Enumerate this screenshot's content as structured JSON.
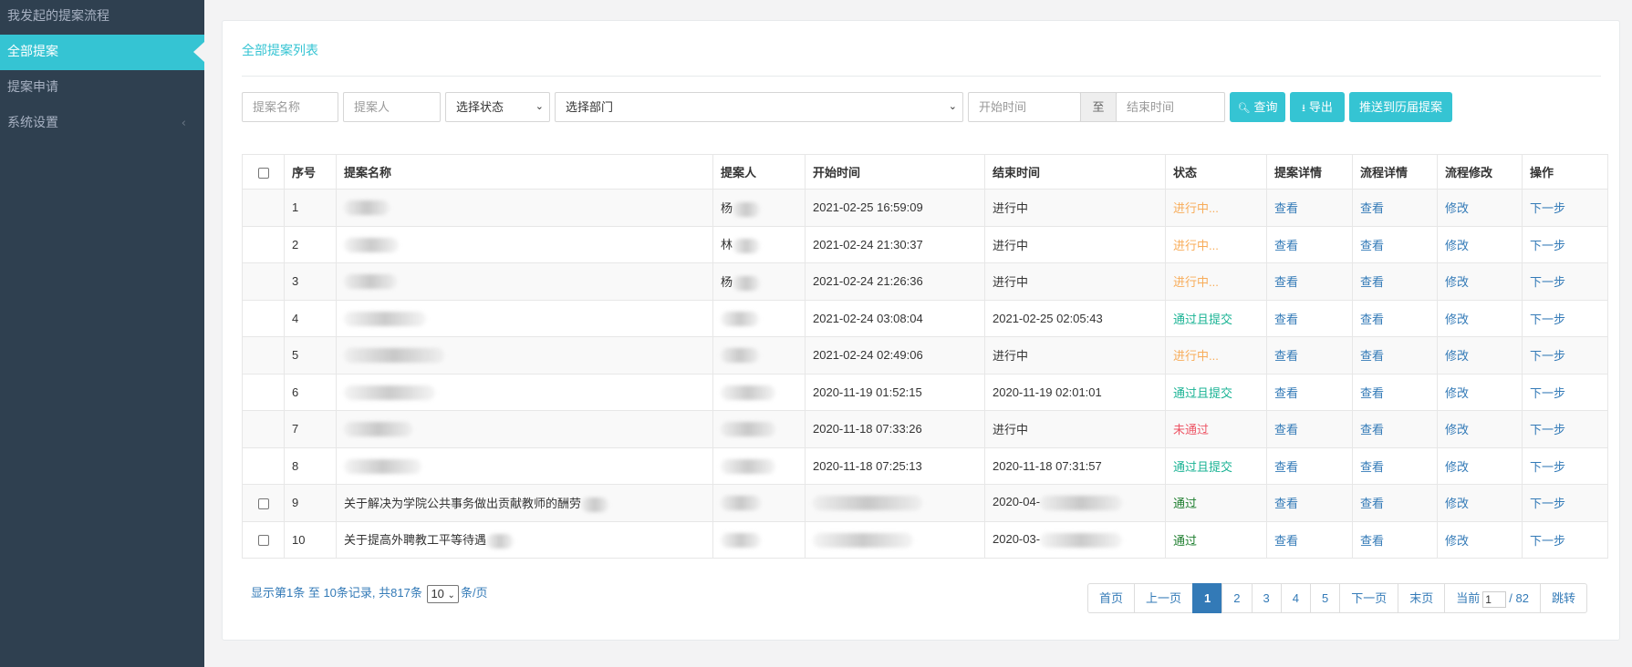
{
  "sidebar": {
    "items": [
      {
        "label": "我发起的提案流程"
      },
      {
        "label": "全部提案"
      },
      {
        "label": "提案申请"
      },
      {
        "label": "系统设置"
      }
    ],
    "chevron": "‹"
  },
  "panel": {
    "title": "全部提案列表"
  },
  "filters": {
    "name_placeholder": "提案名称",
    "person_placeholder": "提案人",
    "status_select": "选择状态",
    "dept_select": "选择部门",
    "start_placeholder": "开始时间",
    "to_label": "至",
    "end_placeholder": "结束时间",
    "query_label": "查询",
    "export_label": "导出",
    "push_label": "推送到历届提案"
  },
  "table": {
    "headers": [
      "序号",
      "提案名称",
      "提案人",
      "开始时间",
      "结束时间",
      "状态",
      "提案详情",
      "流程详情",
      "流程修改",
      "操作"
    ],
    "rows": [
      {
        "no": "1",
        "name": "",
        "person": "杨",
        "start": "2021-02-25 16:59:09",
        "end": "进行中",
        "status": "进行中...",
        "status_type": "going",
        "detail": "查看",
        "flow": "查看",
        "edit": "修改",
        "op": "下一步",
        "checkbox": false
      },
      {
        "no": "2",
        "name": "",
        "person": "林",
        "start": "2021-02-24 21:30:37",
        "end": "进行中",
        "status": "进行中...",
        "status_type": "going",
        "detail": "查看",
        "flow": "查看",
        "edit": "修改",
        "op": "下一步",
        "checkbox": false
      },
      {
        "no": "3",
        "name": "",
        "person": "杨",
        "start": "2021-02-24 21:26:36",
        "end": "进行中",
        "status": "进行中...",
        "status_type": "going",
        "detail": "查看",
        "flow": "查看",
        "edit": "修改",
        "op": "下一步",
        "checkbox": false
      },
      {
        "no": "4",
        "name": "",
        "person": "",
        "start": "2021-02-24 03:08:04",
        "end": "2021-02-25 02:05:43",
        "status": "通过且提交",
        "status_type": "pass",
        "detail": "查看",
        "flow": "查看",
        "edit": "修改",
        "op": "下一步",
        "checkbox": false
      },
      {
        "no": "5",
        "name": "",
        "person": "",
        "start": "2021-02-24 02:49:06",
        "end": "进行中",
        "status": "进行中...",
        "status_type": "going",
        "detail": "查看",
        "flow": "查看",
        "edit": "修改",
        "op": "下一步",
        "checkbox": false
      },
      {
        "no": "6",
        "name": "",
        "person": "",
        "start": "2020-11-19 01:52:15",
        "end": "2020-11-19 02:01:01",
        "status": "通过且提交",
        "status_type": "pass",
        "detail": "查看",
        "flow": "查看",
        "edit": "修改",
        "op": "下一步",
        "checkbox": false
      },
      {
        "no": "7",
        "name": "",
        "person": "",
        "start": "2020-11-18 07:33:26",
        "end": "进行中",
        "status": "未通过",
        "status_type": "fail",
        "detail": "查看",
        "flow": "查看",
        "edit": "修改",
        "op": "下一步",
        "checkbox": false
      },
      {
        "no": "8",
        "name": "",
        "person": "",
        "start": "2020-11-18 07:25:13",
        "end": "2020-11-18 07:31:57",
        "status": "通过且提交",
        "status_type": "pass",
        "detail": "查看",
        "flow": "查看",
        "edit": "修改",
        "op": "下一步",
        "checkbox": false
      },
      {
        "no": "9",
        "name": "关于解决为学院公共事务做出贡献教师的酬劳",
        "person": "",
        "start": "",
        "end": "2020-04-",
        "status": "通过",
        "status_type": "passed",
        "detail": "查看",
        "flow": "查看",
        "edit": "修改",
        "op": "下一步",
        "checkbox": true
      },
      {
        "no": "10",
        "name": "关于提高外聘教工平等待遇",
        "person": "",
        "start": "",
        "end": "2020-03-",
        "status": "通过",
        "status_type": "passed",
        "detail": "查看",
        "flow": "查看",
        "edit": "修改",
        "op": "下一步",
        "checkbox": true
      }
    ]
  },
  "footer": {
    "info_prefix": "显示第1条 至 10条记录, 共817条",
    "page_size": "10",
    "info_suffix": "条/页",
    "pager": {
      "first": "首页",
      "prev": "上一页",
      "pages": [
        "1",
        "2",
        "3",
        "4",
        "5"
      ],
      "next": "下一页",
      "last": "末页",
      "cur_prefix": "当前",
      "cur_value": "1",
      "total": "/ 82",
      "jump": "跳转"
    }
  },
  "colors": {
    "accent": "#35c4d3",
    "sidebar": "#2f4050",
    "link": "#337ab7"
  }
}
